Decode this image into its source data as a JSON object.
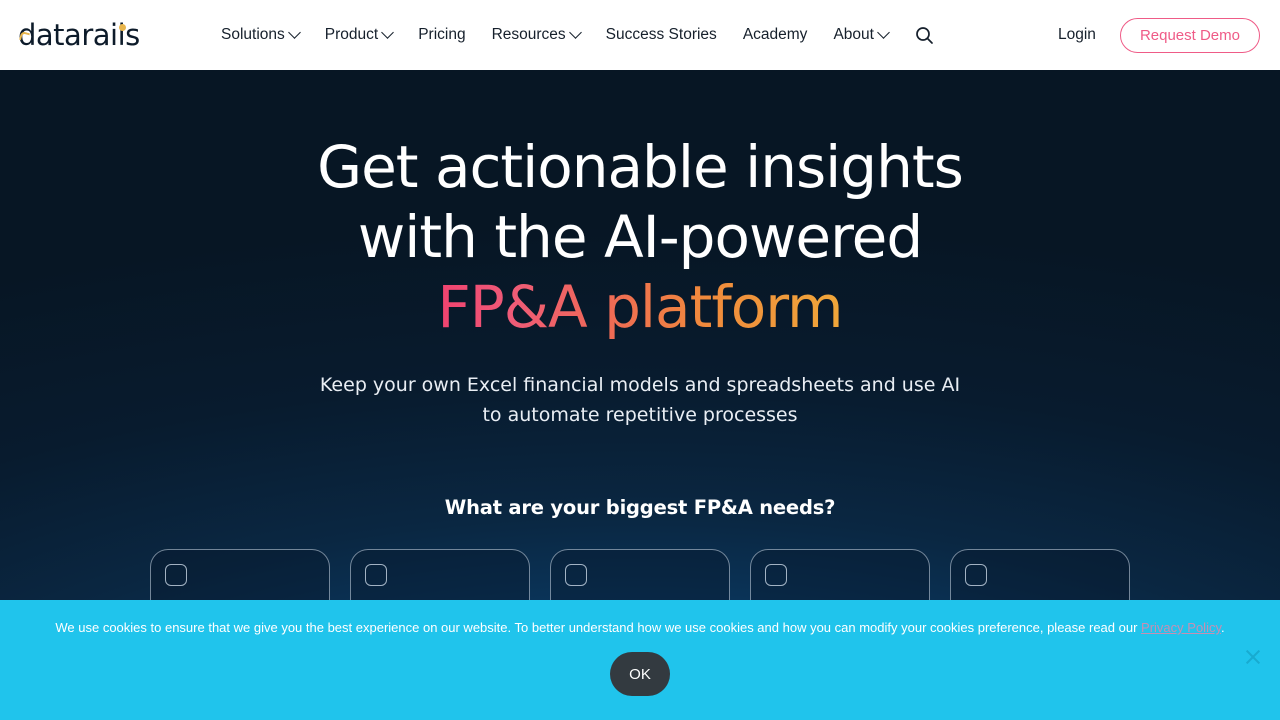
{
  "navbar": {
    "logo_text": "datarails",
    "links": [
      {
        "label": "Solutions",
        "has_chevron": true
      },
      {
        "label": "Product",
        "has_chevron": true
      },
      {
        "label": "Pricing",
        "has_chevron": false
      },
      {
        "label": "Resources",
        "has_chevron": true
      },
      {
        "label": "Success Stories",
        "has_chevron": false
      },
      {
        "label": "Academy",
        "has_chevron": false
      },
      {
        "label": "About",
        "has_chevron": true
      }
    ],
    "search_icon": "search-icon",
    "login_label": "Login",
    "demo_label": "Request Demo",
    "accent_color": "#ef5b87",
    "logo_accent_color": "#e8b54b"
  },
  "hero": {
    "headline_line1": "Get actionable insights",
    "headline_line2": "with the AI-powered",
    "headline_gradient": "FP&A platform",
    "subhead_line1": "Keep your own Excel financial models and spreadsheets and use AI",
    "subhead_line2": "to automate repetitive processes",
    "needs_title": "What are your biggest FP&A needs?",
    "gradient_start": "#f0426f",
    "gradient_end": "#f0a73a",
    "background_dark": "#081b2e",
    "background_blue": "#0e5a93",
    "cards": [
      {
        "icon": "three-people-icon"
      },
      {
        "icon": "document-icon"
      },
      {
        "icon": "document-icon"
      },
      {
        "icon": "circle-icon"
      },
      {
        "icon": "sparkle-icon"
      }
    ]
  },
  "cookie_banner": {
    "text_before_link": "We use cookies to ensure that we give you the best experience on our website. To better understand how we use cookies and how you can modify your cookies preference, please read our ",
    "link_label": "Privacy Policy",
    "text_after_link": ".",
    "ok_label": "OK",
    "close_icon": "close-icon",
    "background_color": "#20c4ec",
    "link_color": "#c78fb3"
  }
}
